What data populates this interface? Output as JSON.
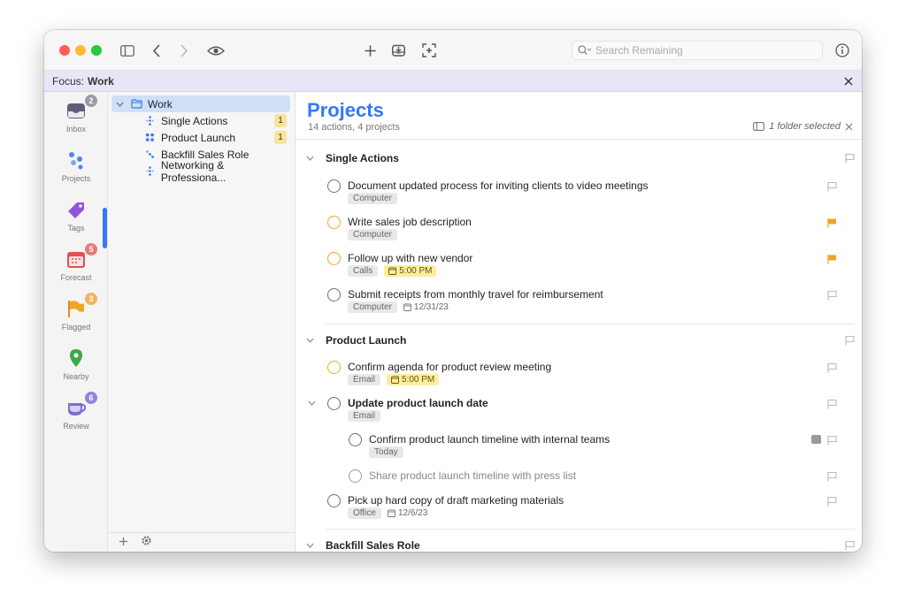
{
  "toolbar": {
    "search_placeholder": "Search Remaining"
  },
  "focus": {
    "prefix": "Focus:",
    "name": "Work"
  },
  "rail": {
    "inbox": {
      "label": "Inbox",
      "badge": "2"
    },
    "projects": {
      "label": "Projects"
    },
    "tags": {
      "label": "Tags"
    },
    "forecast": {
      "label": "Forecast",
      "badge": "5"
    },
    "flagged": {
      "label": "Flagged",
      "badge": "3"
    },
    "nearby": {
      "label": "Nearby"
    },
    "review": {
      "label": "Review",
      "badge": "6"
    }
  },
  "sidebar": {
    "folder": "Work",
    "projects": [
      {
        "label": "Single Actions",
        "count": "1"
      },
      {
        "label": "Product Launch",
        "count": "1"
      },
      {
        "label": "Backfill Sales Role"
      },
      {
        "label": "Networking & Professiona..."
      }
    ]
  },
  "main": {
    "title": "Projects",
    "subtitle": "14 actions, 4 projects",
    "folder_selected": "1 folder selected",
    "sections": [
      {
        "title": "Single Actions"
      },
      {
        "title": "Product Launch"
      },
      {
        "title": "Backfill Sales Role"
      }
    ],
    "tasks": [
      {
        "title": "Document updated process for inviting clients to video meetings",
        "tag": "Computer"
      },
      {
        "title": "Write sales job description",
        "tag": "Computer"
      },
      {
        "title": "Follow up with new vendor",
        "tag": "Calls",
        "due": "5:00 PM"
      },
      {
        "title": "Submit receipts from monthly travel for reimbursement",
        "tag": "Computer",
        "due": "12/31/23"
      },
      {
        "title": "Confirm agenda for product review meeting",
        "tag": "Email",
        "due": "5:00 PM"
      },
      {
        "title": "Update product launch date",
        "tag": "Email"
      },
      {
        "title": "Confirm product launch timeline with internal teams",
        "tag": "Today"
      },
      {
        "title": "Share product launch timeline with press list"
      },
      {
        "title": "Pick up hard copy of draft marketing materials",
        "tag": "Office",
        "due": "12/6/23"
      }
    ]
  },
  "colors": {
    "accent": "#3478f6",
    "flag": "#f1a425",
    "due_highlight": "#fbeea0",
    "focus_bar": "#e9e5f7"
  }
}
